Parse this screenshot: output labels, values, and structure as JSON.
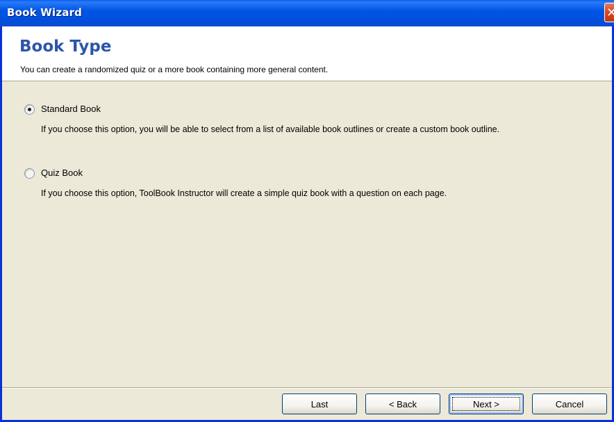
{
  "window": {
    "title": "Book Wizard"
  },
  "header": {
    "title": "Book Type",
    "subtitle": "You can create a randomized quiz or a more book containing more general content."
  },
  "options": [
    {
      "label": "Standard Book",
      "description": "If you choose this option, you will be able to select from a list of available book outlines or create a custom book outline.",
      "selected": true
    },
    {
      "label": "Quiz Book",
      "description": "If you choose this option, ToolBook Instructor will create a simple quiz book with a question on each page.",
      "selected": false
    }
  ],
  "buttons": {
    "last": "Last",
    "back": "< Back",
    "next": "Next >",
    "cancel": "Cancel"
  }
}
